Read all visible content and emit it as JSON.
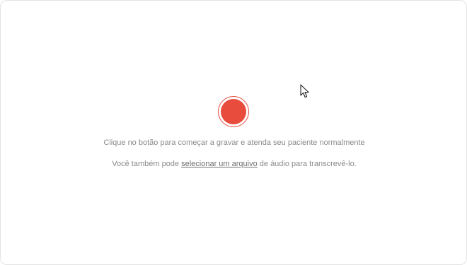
{
  "recorder": {
    "record_button_icon": "record-circle-icon",
    "accent_color": "#e84c3d",
    "instruction_text": "Clique no botão para começar a gravar e atenda seu paciente normalmente",
    "alt_text_before": "Você também pode ",
    "alt_link_text": "selecionar um arquivo",
    "alt_text_after": " de áudio para transcrevê-lo."
  },
  "pointer": {
    "icon": "mouse-pointer-icon"
  }
}
